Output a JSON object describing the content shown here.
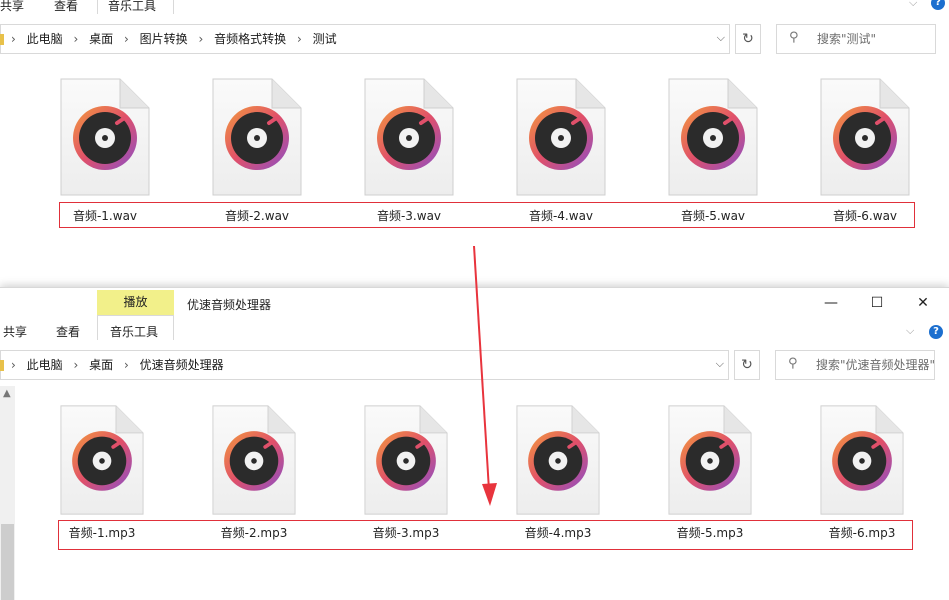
{
  "top_window": {
    "ribbon_tabs": [
      "共享",
      "查看",
      "音乐工具"
    ],
    "breadcrumb": [
      "此电脑",
      "桌面",
      "图片转换",
      "音频格式转换",
      "测试"
    ],
    "search_placeholder": "搜索\"测试\"",
    "files": [
      "音频-1.wav",
      "音频-2.wav",
      "音频-3.wav",
      "音频-4.wav",
      "音频-5.wav",
      "音频-6.wav"
    ]
  },
  "bottom_window": {
    "title": "优速音频处理器",
    "contextual_tab": "播放",
    "ribbon_tabs": [
      "共享",
      "查看",
      "音乐工具"
    ],
    "breadcrumb": [
      "此电脑",
      "桌面",
      "优速音频处理器"
    ],
    "search_placeholder": "搜索\"优速音频处理器\"",
    "files": [
      "音频-1.mp3",
      "音频-2.mp3",
      "音频-3.mp3",
      "音频-4.mp3",
      "音频-5.mp3",
      "音频-6.mp3"
    ]
  },
  "icons": {
    "file_icon": "music-disc-file-icon",
    "search": "search-icon",
    "refresh": "refresh-icon",
    "folder": "folder-icon",
    "help": "help-icon",
    "minimize": "minimize-icon",
    "maximize": "maximize-icon",
    "close": "close-icon",
    "arrow": "red-down-arrow"
  },
  "colors": {
    "highlight_box": "#e0303a",
    "contextual_tab_bg": "#f2f08a",
    "accent_blue": "#1c6fcf"
  }
}
